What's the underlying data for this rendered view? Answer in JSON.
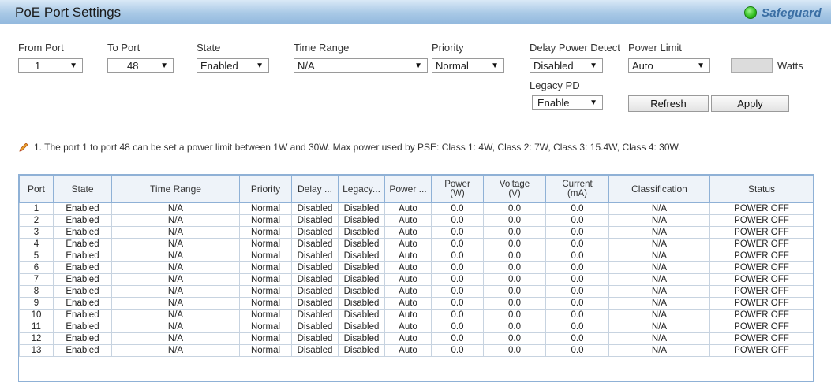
{
  "header": {
    "title": "PoE Port Settings",
    "safeguard": "Safeguard"
  },
  "form": {
    "from_port": {
      "label": "From Port",
      "value": "1"
    },
    "to_port": {
      "label": "To Port",
      "value": "48"
    },
    "state": {
      "label": "State",
      "value": "Enabled"
    },
    "time_range": {
      "label": "Time Range",
      "value": "N/A"
    },
    "priority": {
      "label": "Priority",
      "value": "Normal"
    },
    "delay_power_detect": {
      "label": "Delay Power Detect",
      "value": "Disabled"
    },
    "power_limit": {
      "label": "Power Limit",
      "value": "Auto"
    },
    "watts_label": "Watts",
    "watts_value": "",
    "legacy_pd": {
      "label": "Legacy PD",
      "value": "Enable"
    },
    "refresh_label": "Refresh",
    "apply_label": "Apply"
  },
  "note": "1.  The port 1 to port 48 can be set a power limit between 1W and 30W. Max power used by PSE: Class 1: 4W, Class 2: 7W, Class 3: 15.4W, Class 4: 30W.",
  "table": {
    "headers": [
      "Port",
      "State",
      "Time Range",
      "Priority",
      "Delay ...",
      "Legacy...",
      "Power ...",
      "Power\n(W)",
      "Voltage\n(V)",
      "Current\n(mA)",
      "Classification",
      "Status"
    ],
    "rows": [
      [
        "1",
        "Enabled",
        "N/A",
        "Normal",
        "Disabled",
        "Disabled",
        "Auto",
        "0.0",
        "0.0",
        "0.0",
        "N/A",
        "POWER OFF"
      ],
      [
        "2",
        "Enabled",
        "N/A",
        "Normal",
        "Disabled",
        "Disabled",
        "Auto",
        "0.0",
        "0.0",
        "0.0",
        "N/A",
        "POWER OFF"
      ],
      [
        "3",
        "Enabled",
        "N/A",
        "Normal",
        "Disabled",
        "Disabled",
        "Auto",
        "0.0",
        "0.0",
        "0.0",
        "N/A",
        "POWER OFF"
      ],
      [
        "4",
        "Enabled",
        "N/A",
        "Normal",
        "Disabled",
        "Disabled",
        "Auto",
        "0.0",
        "0.0",
        "0.0",
        "N/A",
        "POWER OFF"
      ],
      [
        "5",
        "Enabled",
        "N/A",
        "Normal",
        "Disabled",
        "Disabled",
        "Auto",
        "0.0",
        "0.0",
        "0.0",
        "N/A",
        "POWER OFF"
      ],
      [
        "6",
        "Enabled",
        "N/A",
        "Normal",
        "Disabled",
        "Disabled",
        "Auto",
        "0.0",
        "0.0",
        "0.0",
        "N/A",
        "POWER OFF"
      ],
      [
        "7",
        "Enabled",
        "N/A",
        "Normal",
        "Disabled",
        "Disabled",
        "Auto",
        "0.0",
        "0.0",
        "0.0",
        "N/A",
        "POWER OFF"
      ],
      [
        "8",
        "Enabled",
        "N/A",
        "Normal",
        "Disabled",
        "Disabled",
        "Auto",
        "0.0",
        "0.0",
        "0.0",
        "N/A",
        "POWER OFF"
      ],
      [
        "9",
        "Enabled",
        "N/A",
        "Normal",
        "Disabled",
        "Disabled",
        "Auto",
        "0.0",
        "0.0",
        "0.0",
        "N/A",
        "POWER OFF"
      ],
      [
        "10",
        "Enabled",
        "N/A",
        "Normal",
        "Disabled",
        "Disabled",
        "Auto",
        "0.0",
        "0.0",
        "0.0",
        "N/A",
        "POWER OFF"
      ],
      [
        "11",
        "Enabled",
        "N/A",
        "Normal",
        "Disabled",
        "Disabled",
        "Auto",
        "0.0",
        "0.0",
        "0.0",
        "N/A",
        "POWER OFF"
      ],
      [
        "12",
        "Enabled",
        "N/A",
        "Normal",
        "Disabled",
        "Disabled",
        "Auto",
        "0.0",
        "0.0",
        "0.0",
        "N/A",
        "POWER OFF"
      ],
      [
        "13",
        "Enabled",
        "N/A",
        "Normal",
        "Disabled",
        "Disabled",
        "Auto",
        "0.0",
        "0.0",
        "0.0",
        "N/A",
        "POWER OFF"
      ]
    ]
  },
  "colors": {
    "title_bar": "#a9c9e6",
    "safeguard_light": "#2fbd1f",
    "table_border": "#8fb1d6"
  }
}
